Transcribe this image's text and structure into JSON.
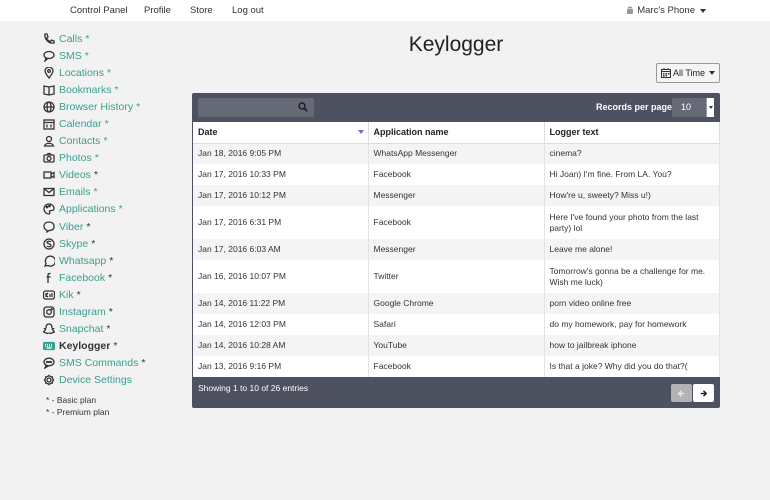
{
  "topnav": {
    "links": [
      "Control Panel",
      "Profile",
      "Store",
      "Log out"
    ],
    "device": "Marc's Phone"
  },
  "sidebar": {
    "items": [
      {
        "label": "Calls",
        "star": "*",
        "icon": "phone-icon"
      },
      {
        "label": "SMS",
        "star": "*",
        "icon": "chat-icon"
      },
      {
        "label": "Locations",
        "star": "*",
        "icon": "map-pin-icon"
      },
      {
        "label": "Bookmarks",
        "star": "*",
        "icon": "book-icon"
      },
      {
        "label": "Browser History",
        "star": "*",
        "icon": "globe-icon"
      },
      {
        "label": "Calendar",
        "star": "*",
        "icon": "calendar-icon"
      },
      {
        "label": "Contacts",
        "star": "*",
        "icon": "user-icon"
      },
      {
        "label": "Photos",
        "star": "*",
        "icon": "camera-icon"
      },
      {
        "label": "Videos",
        "star": "*",
        "icon": "video-icon"
      },
      {
        "label": "Emails",
        "star": "*",
        "icon": "envelope-icon"
      },
      {
        "label": "Applications",
        "star": "*",
        "icon": "palette-icon"
      },
      {
        "label": "Viber",
        "star": "*",
        "icon": "viber-icon"
      },
      {
        "label": "Skype",
        "star": "*",
        "icon": "skype-icon"
      },
      {
        "label": "Whatsapp",
        "star": "*",
        "icon": "whatsapp-icon"
      },
      {
        "label": "Facebook",
        "star": "*",
        "icon": "facebook-icon"
      },
      {
        "label": "Kik",
        "star": "*",
        "icon": "kik-icon"
      },
      {
        "label": "Instagram",
        "star": "*",
        "icon": "instagram-icon"
      },
      {
        "label": "Snapchat",
        "star": "*",
        "icon": "snapchat-icon"
      },
      {
        "label": "Keylogger",
        "star": "*",
        "icon": "keyboard-icon"
      },
      {
        "label": "SMS Commands",
        "star": "*",
        "icon": "sms-command-icon"
      },
      {
        "label": "Device Settings",
        "star": "",
        "icon": "gear-icon"
      }
    ],
    "legend": [
      "* - Basic plan",
      "* - Premium plan"
    ]
  },
  "main": {
    "title": "Keylogger",
    "period_label": "All Time",
    "search_placeholder": "",
    "records_per_page_label": "Records per page:",
    "records_per_page_value": "10",
    "columns": [
      "Date",
      "Application name",
      "Logger text"
    ],
    "rows": [
      [
        "Jan 18, 2016 9:05 PM",
        "WhatsApp Messenger",
        "cinema?"
      ],
      [
        "Jan 17, 2016 10:33 PM",
        "Facebook",
        "Hi Joan) I'm fine. From LA. You?"
      ],
      [
        "Jan 17, 2016 10:12 PM",
        "Messenger",
        "How're u, sweety? Miss u!)"
      ],
      [
        "Jan 17, 2016 6:31 PM",
        "Facebook",
        "Here I've found your photo from the last party) lol"
      ],
      [
        "Jan 17, 2016 6:03 AM",
        "Messenger",
        "Leave me alone!"
      ],
      [
        "Jan 16, 2016 10:07 PM",
        "Twitter",
        "Tomorrow's gonna be a challenge for me. Wish me luck)"
      ],
      [
        "Jan 14, 2016 11:22 PM",
        "Google Chrome",
        "porn video online free"
      ],
      [
        "Jan 14, 2016 12:03 PM",
        "Safari",
        "do my homework, pay for homework"
      ],
      [
        "Jan 14, 2016 10:28 AM",
        "YouTube",
        "how to jailbreak iphone"
      ],
      [
        "Jan 13, 2016 9:16 PM",
        "Facebook",
        "Is that a joke? Why did you do that?("
      ]
    ],
    "footer_info": "Showing 1 to 10 of 26 entries"
  },
  "colors": {
    "accent": "#3a9f8f",
    "panel": "#4e5160",
    "background": "#f2f2f2"
  }
}
